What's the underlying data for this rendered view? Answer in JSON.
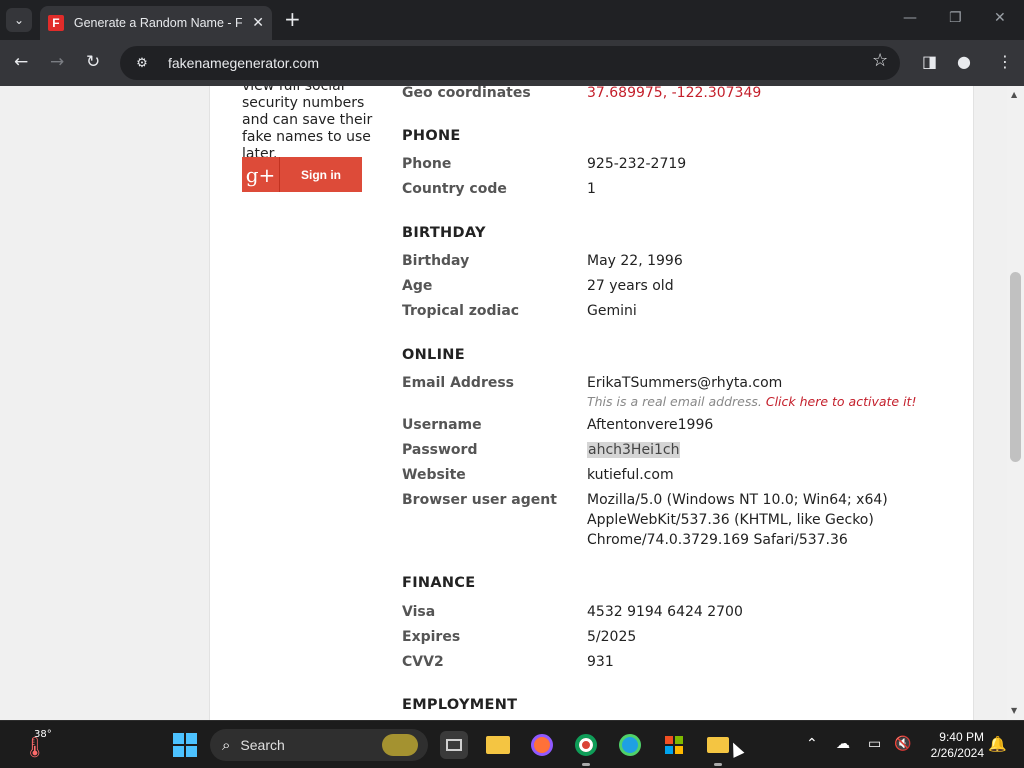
{
  "browser": {
    "tab_title": "Generate a Random Name - Fake Name Generator",
    "favicon_letter": "F",
    "url": "fakenamegenerator.com"
  },
  "sidebar": {
    "text": "view full social security numbers and can save their fake names to use later.",
    "signin_icon": "g+",
    "signin_label": "Sign in"
  },
  "identity": {
    "geo_label": "Geo coordinates",
    "geo_value": "37.689975, -122.307349",
    "phone": {
      "heading": "PHONE",
      "phone_label": "Phone",
      "phone_value": "925-232-2719",
      "country_code_label": "Country code",
      "country_code_value": "1"
    },
    "birthday": {
      "heading": "BIRTHDAY",
      "birthday_label": "Birthday",
      "birthday_value": "May 22, 1996",
      "age_label": "Age",
      "age_value": "27 years old",
      "zodiac_label": "Tropical zodiac",
      "zodiac_value": "Gemini"
    },
    "online": {
      "heading": "ONLINE",
      "email_label": "Email Address",
      "email_value": "ErikaTSummers@rhyta.com",
      "email_hint": "This is a real email address.",
      "email_link": "Click here to activate it!",
      "username_label": "Username",
      "username_value": "Aftentonvere1996",
      "password_label": "Password",
      "password_value": "ahch3Hei1ch",
      "website_label": "Website",
      "website_value": "kutieful.com",
      "ua_label": "Browser user agent",
      "ua_line1": "Mozilla/5.0 (Windows NT 10.0; Win64; x64)",
      "ua_line2": "AppleWebKit/537.36 (KHTML, like Gecko)",
      "ua_line3": "Chrome/74.0.3729.169 Safari/537.36"
    },
    "finance": {
      "heading": "FINANCE",
      "visa_label": "Visa",
      "visa_value": "4532 9194 6424 2700",
      "expires_label": "Expires",
      "expires_value": "5/2025",
      "cvv_label": "CVV2",
      "cvv_value": "931"
    },
    "employment": {
      "heading": "EMPLOYMENT"
    }
  },
  "taskbar": {
    "temperature": "38°",
    "search_label": "Search",
    "time": "9:40 PM",
    "date": "2/26/2024"
  },
  "colors": {
    "accent_red": "#c41f2b",
    "google_red": "#dd4b39"
  }
}
